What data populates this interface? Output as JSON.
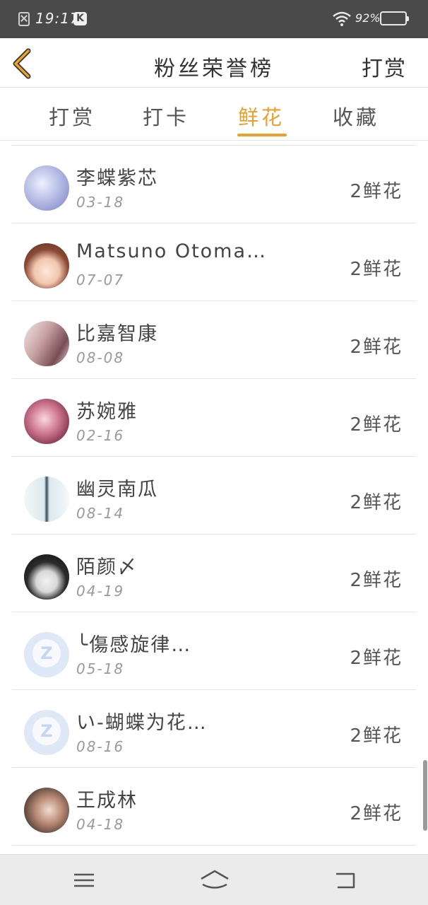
{
  "status_bar": {
    "time": "19:17",
    "app_badge": "K",
    "battery": "92%",
    "battery_level": 0.92,
    "icons": [
      "sim-disabled-icon",
      "k-app-icon",
      "wifi-icon",
      "battery-icon"
    ]
  },
  "nav": {
    "title": "粉丝荣誉榜",
    "right_action": "打赏",
    "back_icon": "chevron-left-icon",
    "accent_color": "#eea02c"
  },
  "tabs": [
    {
      "label": "打赏",
      "active": false
    },
    {
      "label": "打卡",
      "active": false
    },
    {
      "label": "鲜花",
      "active": true
    },
    {
      "label": "收藏",
      "active": false
    }
  ],
  "fans": [
    {
      "name": "李蝶紫芯",
      "date": "03-18",
      "amount": "2鲜花"
    },
    {
      "name": "Matsuno Otoma…",
      "date": "07-07",
      "amount": "2鲜花"
    },
    {
      "name": "比嘉智康",
      "date": "08-08",
      "amount": "2鲜花"
    },
    {
      "name": "苏婉雅",
      "date": "02-16",
      "amount": "2鲜花"
    },
    {
      "name": "幽灵南瓜",
      "date": "08-14",
      "amount": "2鲜花"
    },
    {
      "name": "陌颜〆",
      "date": "04-19",
      "amount": "2鲜花"
    },
    {
      "name": "╰傷感旋律…",
      "date": "05-18",
      "amount": "2鲜花"
    },
    {
      "name": "い-蝴蝶为花…",
      "date": "08-16",
      "amount": "2鲜花"
    },
    {
      "name": "王成林",
      "date": "04-18",
      "amount": "2鲜花"
    }
  ],
  "bottom_nav": {
    "icons": [
      "menu-icon",
      "home-icon",
      "back-icon"
    ]
  }
}
